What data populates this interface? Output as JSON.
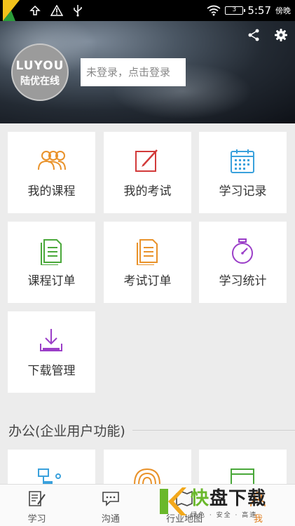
{
  "status_bar": {
    "time": "5:57",
    "extra": "傍晚",
    "battery": "3"
  },
  "header": {
    "avatar_line1": "LUYOU",
    "avatar_line2": "陆优在线",
    "login_text": "未登录，点击登录"
  },
  "menu": [
    {
      "label": "我的课程",
      "icon": "users-icon",
      "color": "#e9922a"
    },
    {
      "label": "我的考试",
      "icon": "edit-square-icon",
      "color": "#d23a3a"
    },
    {
      "label": "学习记录",
      "icon": "calendar-icon",
      "color": "#3aa1dc"
    },
    {
      "label": "课程订单",
      "icon": "document-list-icon",
      "color": "#4aa83a"
    },
    {
      "label": "考试订单",
      "icon": "document-list-icon",
      "color": "#e9922a"
    },
    {
      "label": "学习统计",
      "icon": "stopwatch-icon",
      "color": "#9b3ec8"
    },
    {
      "label": "下载管理",
      "icon": "download-icon",
      "color": "#9b3ec8"
    }
  ],
  "section_title": "办公(企业用户功能)",
  "tabs": [
    {
      "label": "学习",
      "icon": "book-edit-icon"
    },
    {
      "label": "沟通",
      "icon": "chat-icon"
    },
    {
      "label": "行业地图",
      "icon": "map-icon"
    },
    {
      "label": "我",
      "icon": "user-icon"
    }
  ],
  "watermark": {
    "char": "快",
    "title": "盘下载",
    "slogan": "绿色 · 安全 · 高速"
  }
}
